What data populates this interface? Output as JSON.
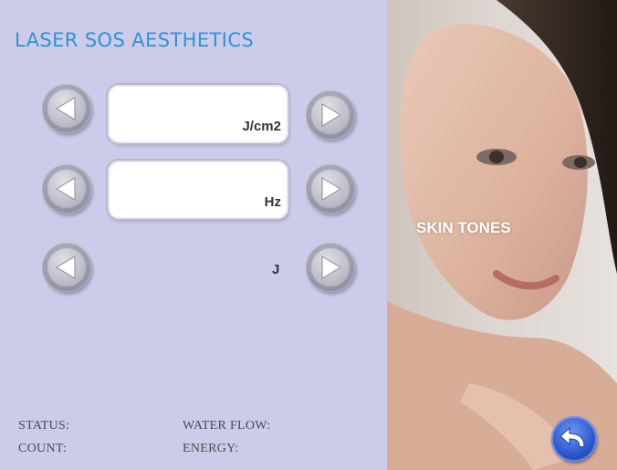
{
  "app": {
    "title": "LASER SOS AESTHETICS"
  },
  "controls": [
    {
      "id": "fluence",
      "unit": "J/cm2",
      "value": ""
    },
    {
      "id": "frequency",
      "unit": "Hz",
      "value": ""
    },
    {
      "id": "energy",
      "unit": "J",
      "value": ""
    }
  ],
  "status_bar": {
    "status_label": "STATUS:",
    "water_flow_label": "WATER FLOW:",
    "count_label": "COUNT:",
    "energy_label": "ENERGY:"
  },
  "side_panel": {
    "skin_tones_label": "SKIN TONES"
  },
  "icons": {
    "decrease": "triangle-left-icon",
    "increase": "triangle-right-icon",
    "back": "undo-arrow-icon"
  },
  "colors": {
    "panel_background": "#ccccea",
    "title_blue": "#2f93d6",
    "back_button_blue": "#2854cc"
  }
}
